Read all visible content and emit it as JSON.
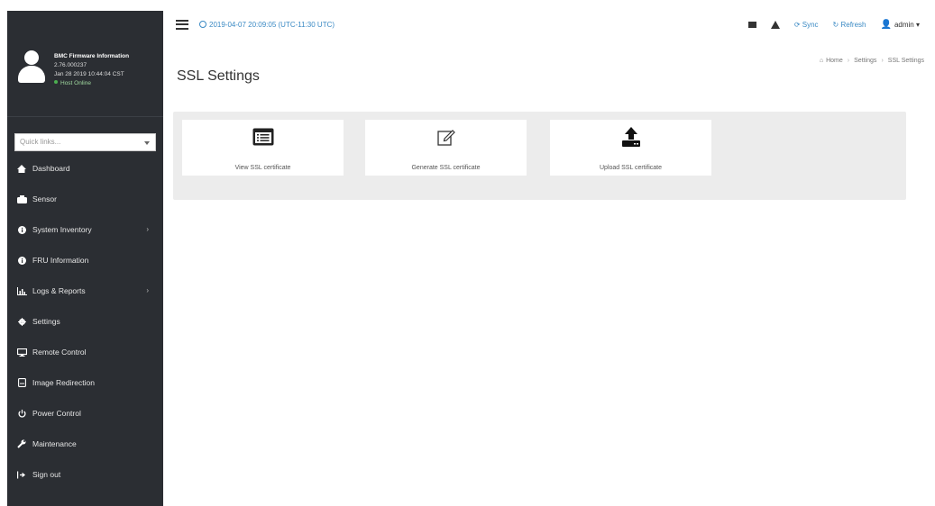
{
  "profile": {
    "title": "BMC Firmware Information",
    "version": "2.76.000237",
    "build_date": "Jan 28 2019 10:44:04 CST",
    "status": "Host Online"
  },
  "quicklinks": {
    "placeholder": "Quick links..."
  },
  "menu": [
    {
      "label": "Dashboard",
      "icon": "dashboard-icon",
      "arrow": false
    },
    {
      "label": "Sensor",
      "icon": "sensor-icon",
      "arrow": false
    },
    {
      "label": "System Inventory",
      "icon": "info-icon",
      "arrow": true
    },
    {
      "label": "FRU Information",
      "icon": "info-icon",
      "arrow": false
    },
    {
      "label": "Logs & Reports",
      "icon": "chart-icon",
      "arrow": true
    },
    {
      "label": "Settings",
      "icon": "gear-icon",
      "arrow": false
    },
    {
      "label": "Remote Control",
      "icon": "monitor-icon",
      "arrow": false
    },
    {
      "label": "Image Redirection",
      "icon": "disc-icon",
      "arrow": false
    },
    {
      "label": "Power Control",
      "icon": "power-icon",
      "arrow": false
    },
    {
      "label": "Maintenance",
      "icon": "wrench-icon",
      "arrow": false
    },
    {
      "label": "Sign out",
      "icon": "signout-icon",
      "arrow": false
    }
  ],
  "header": {
    "datetime": "2019-04-07 20:09:05 (UTC-11:30 UTC)",
    "sync_label": "Sync",
    "refresh_label": "Refresh",
    "user_label": "admin"
  },
  "page": {
    "title": "SSL Settings",
    "breadcrumb": [
      "Home",
      "Settings",
      "SSL Settings"
    ]
  },
  "tiles": [
    {
      "label": "View SSL certificate",
      "icon": "certificate-list-icon"
    },
    {
      "label": "Generate SSL certificate",
      "icon": "edit-icon"
    },
    {
      "label": "Upload SSL certificate",
      "icon": "upload-icon"
    }
  ]
}
